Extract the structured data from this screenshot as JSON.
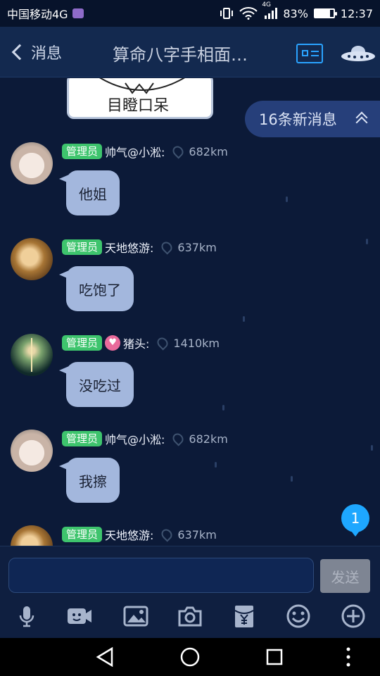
{
  "status_bar": {
    "carrier": "中国移动4G",
    "network_tag": "4G",
    "battery": "83%",
    "battery_level": 0.83,
    "time": "12:37"
  },
  "header": {
    "back_label": "消息",
    "title": "算命八字手相面…"
  },
  "sticker": {
    "text": "目瞪口呆"
  },
  "new_messages": {
    "label": "16条新消息"
  },
  "messages": [
    {
      "badge": "管理员",
      "name": "帅气@小淞:",
      "distance": "682km",
      "text": "他姐",
      "avatar": "cat-avatar"
    },
    {
      "badge": "管理员",
      "name": "天地悠游:",
      "distance": "637km",
      "text": "吃饱了",
      "avatar": "girl-avatar"
    },
    {
      "badge": "管理员",
      "name": "猪头:",
      "distance": "1410km",
      "text": "没吃过",
      "avatar": "night-sky-avatar",
      "heart": "♥"
    },
    {
      "badge": "管理员",
      "name": "帅气@小淞:",
      "distance": "682km",
      "text": "我擦",
      "avatar": "cat-avatar"
    },
    {
      "badge": "管理员",
      "name": "天地悠游:",
      "distance": "637km",
      "text": "",
      "avatar": "girl-avatar"
    }
  ],
  "unread_count": "1",
  "composer": {
    "value": "",
    "send_label": "发送"
  },
  "toolbar": [
    "mic-icon",
    "video-icon",
    "image-icon",
    "camera-icon",
    "red-packet-icon",
    "emoji-icon",
    "plus-icon"
  ],
  "colors": {
    "accent": "#1ea7ff",
    "badge": "#3ec46d",
    "bubble": "#a3b7dd",
    "background": "#0c1a38"
  }
}
